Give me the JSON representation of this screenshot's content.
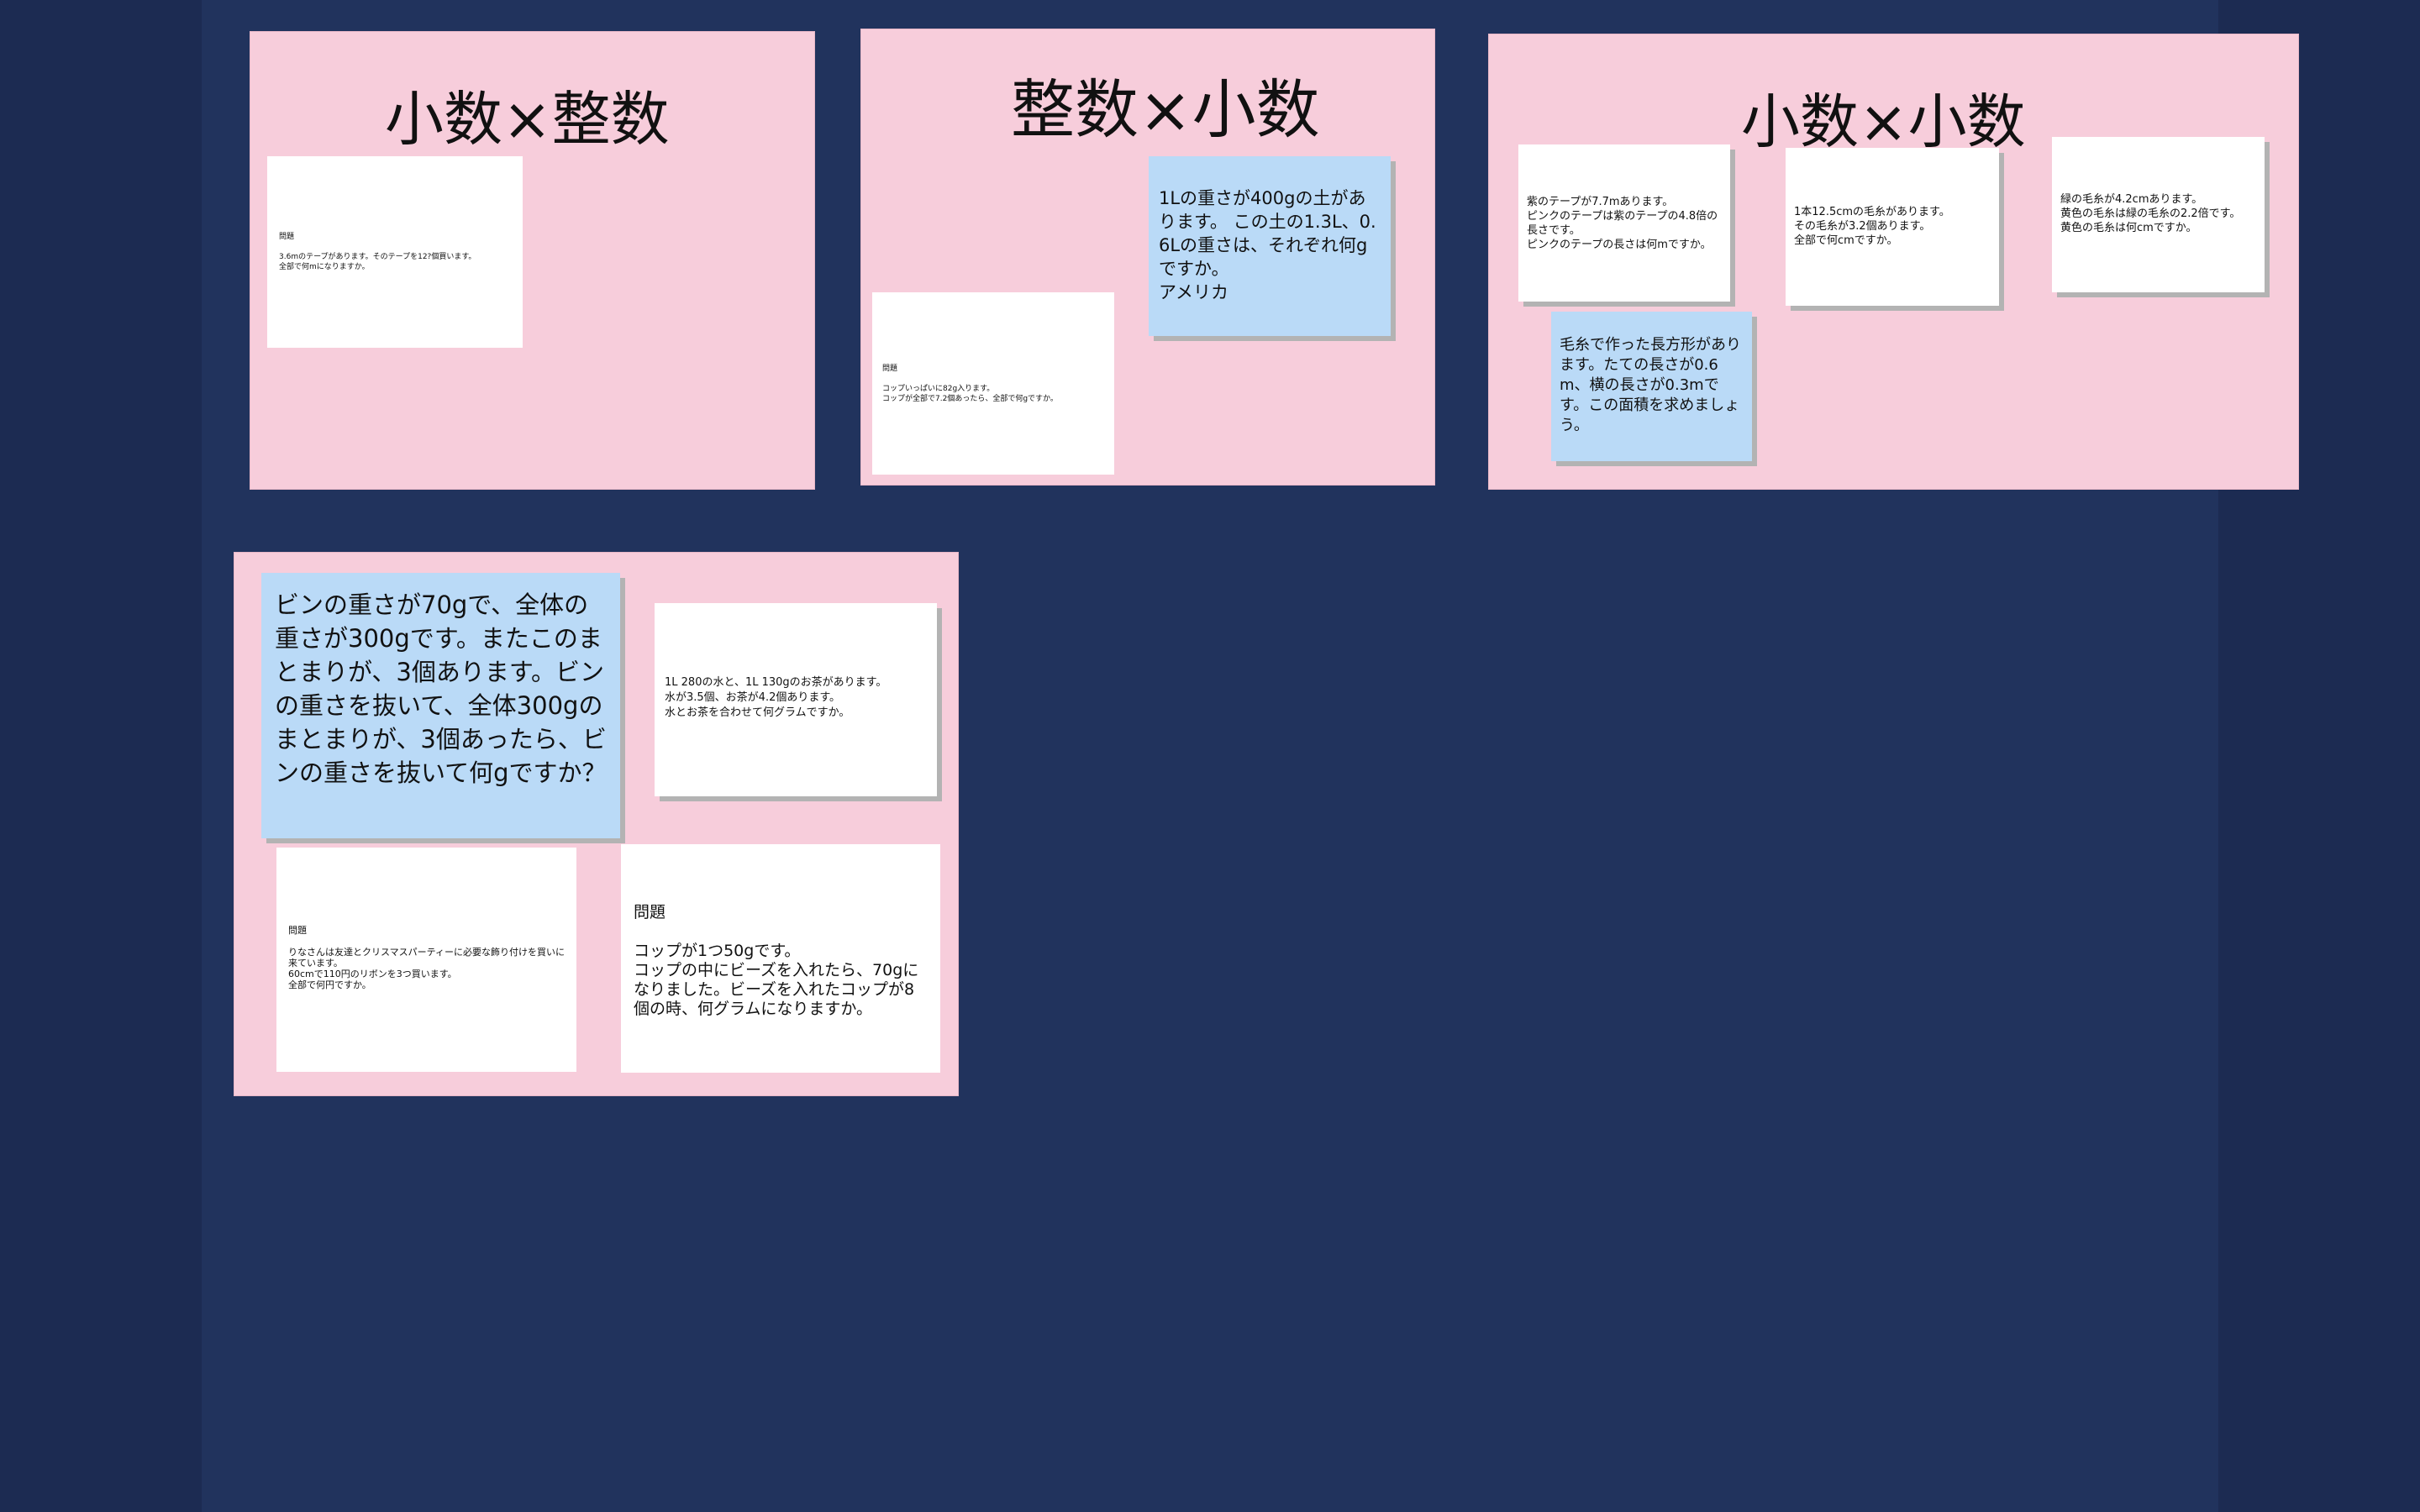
{
  "board": {
    "frames": [
      {
        "title": "小数×整数",
        "notes": [
          {
            "id": "f1-n1",
            "text": "問題\n\n3.6mのテープがあります。そのテープを12?個買います。\n全部で何mになりますか。"
          }
        ]
      },
      {
        "title": "整数×小数",
        "notes": [
          {
            "id": "f2-n1",
            "text": "1Lの重さが400gの土があります。 この土の1.3L、0.6Lの重さは、それぞれ何gですか。\nアメリカ"
          },
          {
            "id": "f2-n2",
            "text": "問題\n\nコップいっぱいに82g入ります。\nコップが全部で7.2個あったら、全部で何gですか。"
          }
        ]
      },
      {
        "title": "小数×小数",
        "notes": [
          {
            "id": "f3-n1",
            "text": "紫のテープが7.7mあります。\nピンクのテープは紫のテープの4.8倍の長さです。\nピンクのテープの長さは何mですか。"
          },
          {
            "id": "f3-n2",
            "text": "1本12.5cmの毛糸があります。\nその毛糸が3.2個あります。\n全部で何cmですか。"
          },
          {
            "id": "f3-n3",
            "text": "緑の毛糸が4.2cmあります。\n黄色の毛糸は緑の毛糸の2.2倍です。\n黄色の毛糸は何cmですか。"
          },
          {
            "id": "f3-n4",
            "text": "毛糸で作った長方形があります。たての長さが0.6m、横の長さが0.3mです。この面積を求めましょう。"
          }
        ]
      },
      {
        "title": "",
        "notes": [
          {
            "id": "f4-n1",
            "text": "ビンの重さが70gで、全体の重さが300gです。またこのまとまりが、3個あります。ビンの重さを抜いて、全体300gのまとまりが、3個あったら、ビンの重さを抜いて何gですか？"
          },
          {
            "id": "f4-n2",
            "text": "1L 280の水と、1L 130gのお茶があります。\n水が3.5個、お茶が4.2個あります。\n水とお茶を合わせて何グラムですか。"
          },
          {
            "id": "f4-n3",
            "text": "問題\n\nりなさんは友達とクリスマスパーティーに必要な飾り付けを買いに来ています。\n60cmで110円のリボンを3つ買います。\n全部で何円ですか。"
          },
          {
            "id": "f4-n4",
            "text": "問題\n\nコップが1つ50gです。\nコップの中にビーズを入れたら、70gになりました。ビーズを入れたコップが8個の時、何グラムになりますか。"
          }
        ]
      }
    ]
  },
  "colors": {
    "page_bg": "#1c2b52",
    "canvas_bg": "#21335d",
    "frame_bg": "#f7cddb",
    "note_white": "#ffffff",
    "note_blue": "#badaf7"
  }
}
